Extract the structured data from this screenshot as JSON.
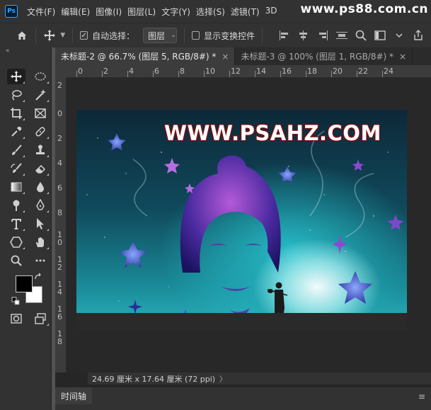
{
  "app": {
    "logo": "Ps"
  },
  "menubar": {
    "items": [
      "文件(F)",
      "编辑(E)",
      "图像(I)",
      "图层(L)",
      "文字(Y)",
      "选择(S)",
      "滤镜(T)",
      "3D"
    ],
    "watermark": "www.ps88.com.cn"
  },
  "options": {
    "auto_select_label": "自动选择：",
    "auto_select_checked": true,
    "target_value": "图层",
    "transform_controls_label": "显示变换控件",
    "transform_controls_checked": false
  },
  "tabs": [
    {
      "label": "未标题-2 @ 66.7% (图层 5, RGB/8#) *",
      "close": "×",
      "active": true
    },
    {
      "label": "未标题-3 @ 100% (图层 1, RGB/8#) *",
      "close": "×",
      "active": false
    }
  ],
  "ruler": {
    "horizontal": [
      "0",
      "2",
      "4",
      "6",
      "8",
      "10",
      "12",
      "14",
      "16",
      "18",
      "20",
      "22",
      "24"
    ],
    "vertical": [
      "2",
      "0",
      "2",
      "4",
      "6",
      "8",
      "1\n0",
      "1\n2",
      "1\n4",
      "1\n6",
      "1\n8"
    ]
  },
  "artwork": {
    "headline": "WWW.PSAHZ.COM"
  },
  "status": {
    "doc_size": "24.69 厘米 x 17.64 厘米 (72 ppi)",
    "arrow": "〉"
  },
  "timeline": {
    "tab_label": "时间轴",
    "menu_icon": "≡"
  },
  "colors": {
    "foreground": "#000000",
    "background": "#ffffff",
    "accent": "#31a8ff"
  }
}
